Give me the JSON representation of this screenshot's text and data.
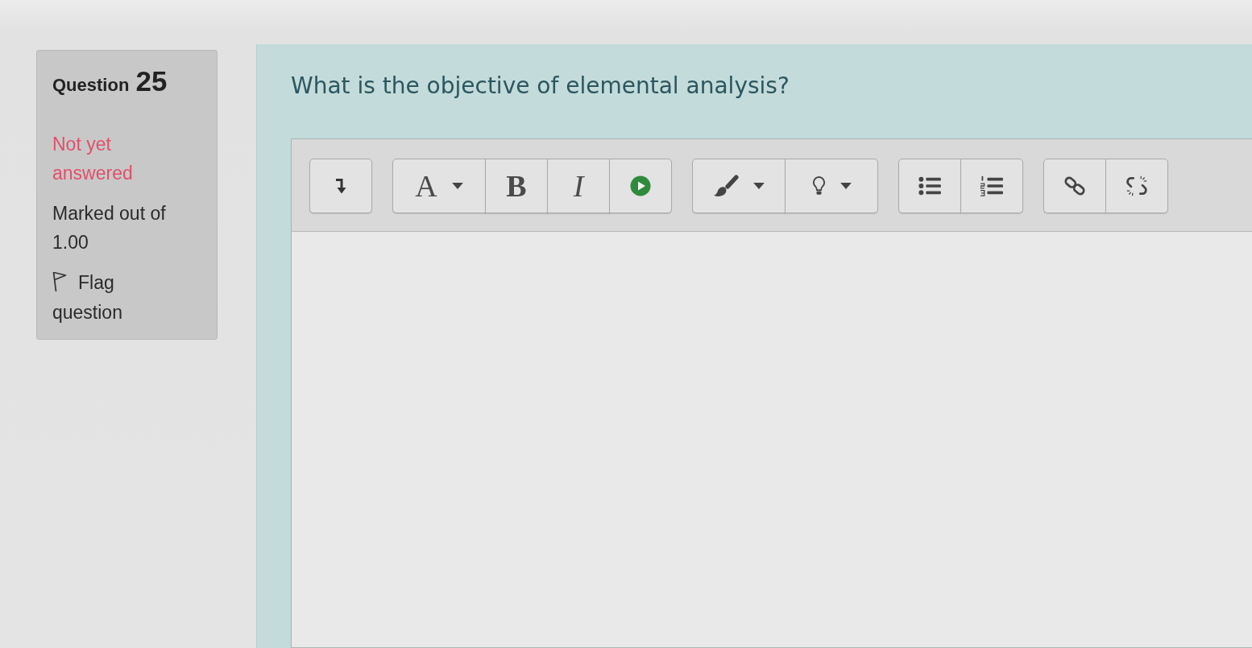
{
  "question_info": {
    "title": "Question",
    "number": "25",
    "status": "Not yet answered",
    "marks": "Marked out of 1.00",
    "flag": {
      "label": "Flag question",
      "flagged": false
    }
  },
  "question": {
    "text": "What is the objective of elemental analysis?"
  },
  "editor": {
    "toolbar": [
      {
        "buttons": [
          {
            "kind": "more",
            "dropdown": false
          }
        ]
      },
      {
        "buttons": [
          {
            "kind": "style",
            "label": "A",
            "dropdown": true
          },
          {
            "kind": "bold",
            "label": "B",
            "dropdown": false
          },
          {
            "kind": "italic",
            "label": "I",
            "dropdown": false
          },
          {
            "kind": "media",
            "dropdown": false
          }
        ]
      },
      {
        "buttons": [
          {
            "kind": "color",
            "dropdown": true
          },
          {
            "kind": "bulb",
            "dropdown": true
          }
        ]
      },
      {
        "buttons": [
          {
            "kind": "bullets",
            "dropdown": false
          },
          {
            "kind": "numbers",
            "dropdown": false
          }
        ]
      },
      {
        "buttons": [
          {
            "kind": "link",
            "dropdown": false
          },
          {
            "kind": "unlink",
            "dropdown": false
          }
        ]
      }
    ]
  }
}
